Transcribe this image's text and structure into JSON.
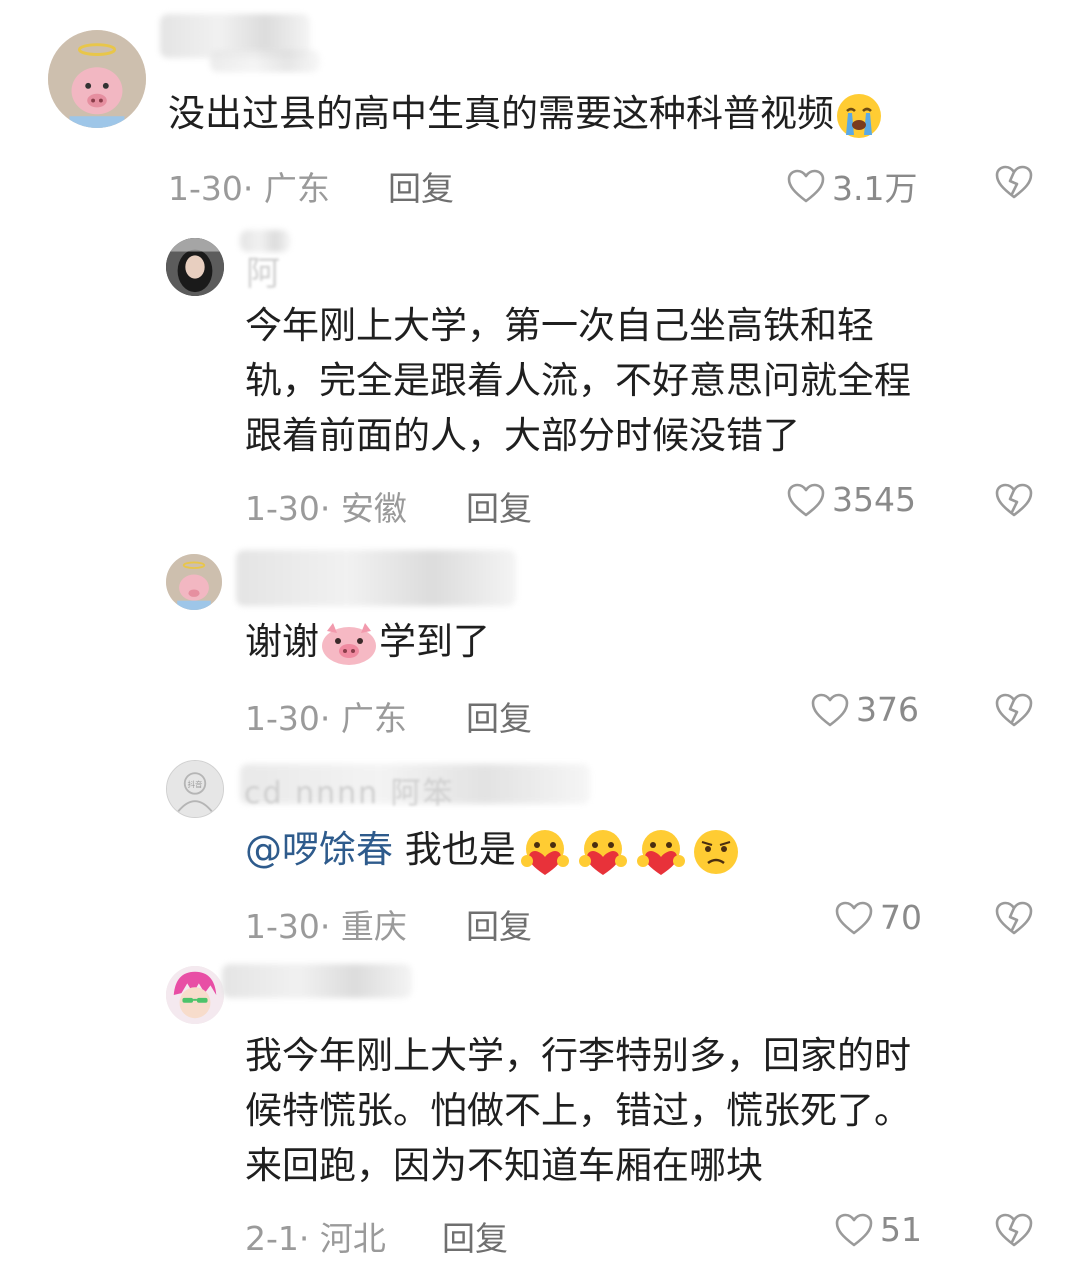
{
  "comments": [
    {
      "text": "没出过县的高中生真的需要这种科普视频",
      "emoji": "crying-face",
      "date": "1-30",
      "region": "广东",
      "reply_label": "回复",
      "likes": "3.1万"
    },
    {
      "text_lines": [
        "今年刚上大学，第一次自己坐高铁和轻",
        "轨，完全是跟着人流，不好意思问就全程",
        "跟着前面的人，大部分时候没错了"
      ],
      "username_fragment": "阿",
      "date": "1-30",
      "region": "安徽",
      "reply_label": "回复",
      "likes": "3545"
    },
    {
      "text_before": "谢谢",
      "emoji": "pig-face",
      "text_after": "学到了",
      "date": "1-30",
      "region": "广东",
      "reply_label": "回复",
      "likes": "376"
    },
    {
      "username_fragment": "cd    nnnn   阿笨",
      "avatar_label": "抖音",
      "mention": "@啰馀春",
      "text": "我也是",
      "emojis": [
        "heart-hug-face",
        "heart-hug-face",
        "heart-hug-face",
        "worried-face"
      ],
      "date": "1-30",
      "region": "重庆",
      "reply_label": "回复",
      "likes": "70"
    },
    {
      "text_lines": [
        "我今年刚上大学，行李特别多，回家的时",
        "候特慌张。怕做不上，错过，慌张死了。",
        "来回跑，因为不知道车厢在哪块"
      ],
      "date": "2-1",
      "region": "河北",
      "reply_label": "回复",
      "likes": "51"
    }
  ],
  "colors": {
    "text": "#1f1f1f",
    "meta": "#9a9a9a",
    "mention": "#2e5b8c",
    "icon": "#8a8a8a"
  }
}
